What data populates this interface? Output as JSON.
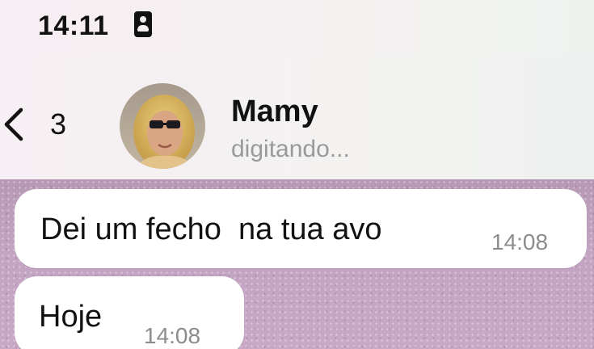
{
  "status_bar": {
    "time": "14:11",
    "icon": "contact-card-icon"
  },
  "header": {
    "back_icon": "chevron-left-icon",
    "back_count": "3",
    "avatar_icon": "contact-avatar",
    "contact_name": "Mamy",
    "contact_status": "digitando..."
  },
  "messages": [
    {
      "text": "Dei um fecho  na tua avo",
      "time": "14:08"
    },
    {
      "text": "Hoje",
      "time": "14:08"
    }
  ],
  "colors": {
    "chat_background": "#c3a3c2",
    "bubble_background": "#ffffff",
    "status_text": "#9a9a9a",
    "primary_text": "#111111"
  }
}
